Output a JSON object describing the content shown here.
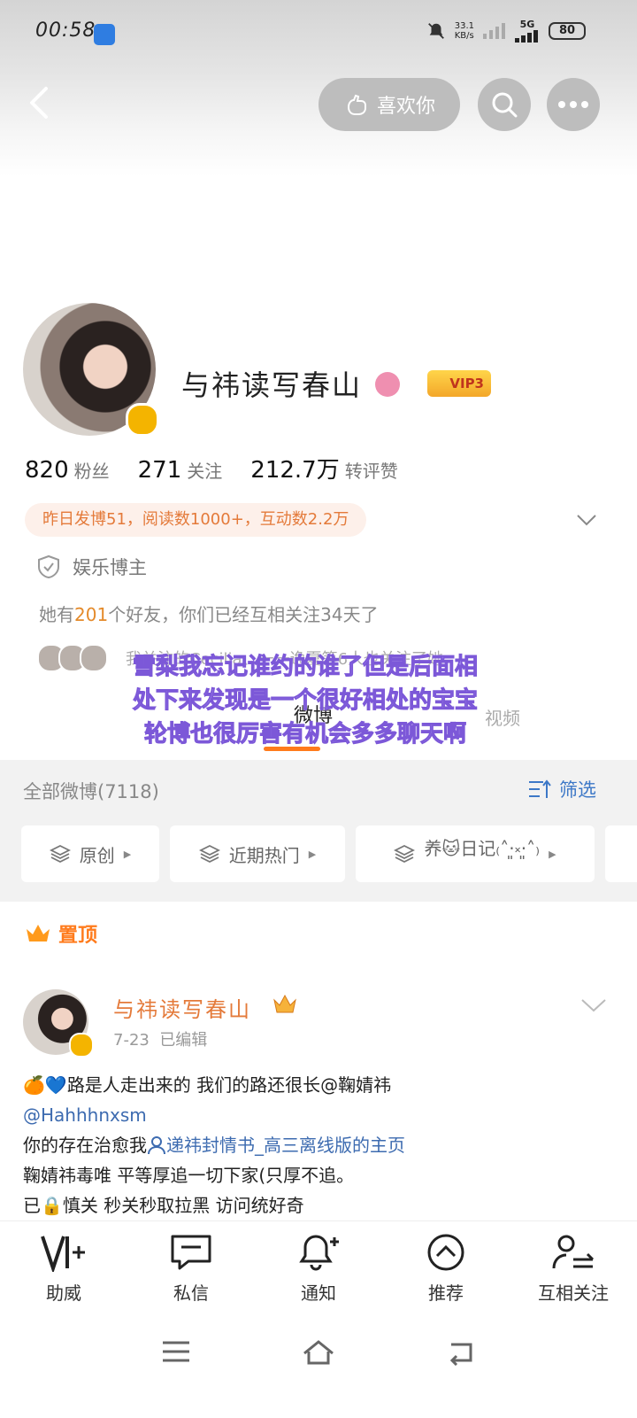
{
  "status_bar": {
    "time": "00:58",
    "net_speed": "33.1",
    "net_unit": "KB/s",
    "network": "5G",
    "battery": "80"
  },
  "header": {
    "like_label": "喜欢你",
    "icons": [
      "back-icon",
      "hand-heart-icon",
      "search-icon",
      "more-icon"
    ]
  },
  "profile": {
    "name": "与祎读写春山",
    "vip_label": "VIP3",
    "stats": [
      {
        "num": "820",
        "label": "粉丝"
      },
      {
        "num": "271",
        "label": "关注"
      },
      {
        "num": "212.7万",
        "label": "转评赞"
      }
    ],
    "yesterday": "昨日发博51，阅读数1000+，互动数2.2万",
    "role": "娱乐博主",
    "friends_prefix": "她有",
    "friends_count": "201",
    "friends_suffix": "个好友，你们已经互相关注34天了",
    "mutual_text": "我关注的Cecilia、一一逸夏等6人也关注了她",
    "overlay_lines": [
      "雪梨我忘记谁约的谁了但是后面相",
      "处下来发现是一个很好相处的宝宝",
      "轮博也很厉害有机会多多聊天啊"
    ],
    "tab_active": "微博",
    "tab_video": "视频"
  },
  "filter_bar": {
    "all_posts": "全部微博(7118)",
    "filter_label": "筛选",
    "chips": [
      "原创",
      "近期热门",
      "养🐱日记₍˄·͈༝·͈˄₎"
    ]
  },
  "post": {
    "pinned_label": "置顶",
    "author": "与祎读写春山",
    "date": "7-23",
    "edited": "已编辑",
    "line1_emoji": "🍊💙",
    "line1": "路是人走出来的 我们的路还很长@鞠婧祎",
    "line2": "@Hahhhnxsm",
    "line3_prefix": "你的存在治愈我",
    "line3_link": "递祎封情书_高三离线版的主页",
    "line4": "鞠婧祎毒唯 平等厚追一切下家(只厚不追。",
    "line5": "已🔒慎关 秒关秒取拉黑 访问统好奇"
  },
  "tabbar": [
    {
      "label": "助威",
      "icon": "cheer-icon"
    },
    {
      "label": "私信",
      "icon": "message-icon"
    },
    {
      "label": "通知",
      "icon": "bell-icon"
    },
    {
      "label": "推荐",
      "icon": "recommend-icon"
    },
    {
      "label": "互相关注",
      "icon": "mutual-follow-icon"
    }
  ]
}
